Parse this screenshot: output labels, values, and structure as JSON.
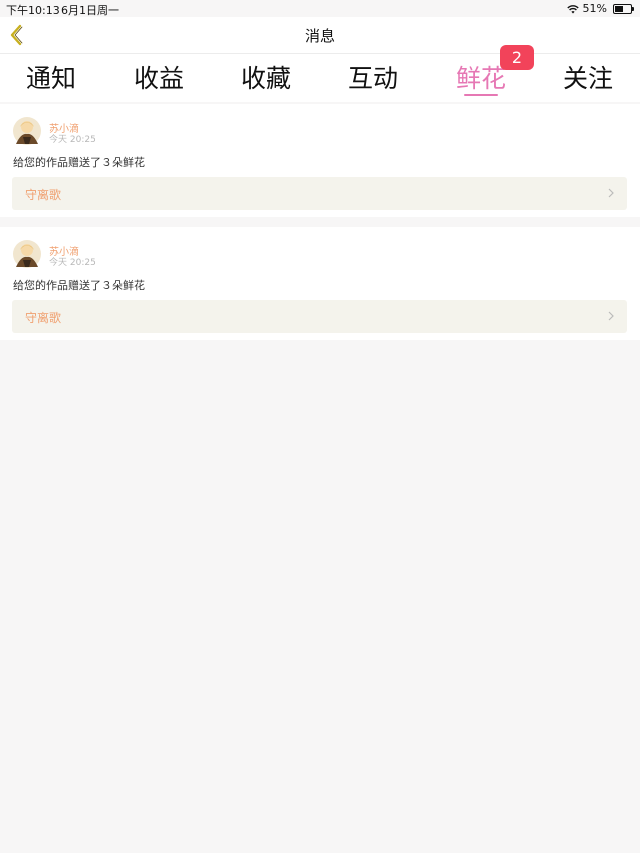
{
  "status_bar": {
    "time": "下午10:13",
    "date": "6月1日周一",
    "battery": "51%",
    "battery_level": 0.51
  },
  "nav": {
    "title": "消息",
    "back_icon": "chevron-left-icon"
  },
  "tabs": [
    {
      "label": "通知"
    },
    {
      "label": "收益"
    },
    {
      "label": "收藏"
    },
    {
      "label": "互动"
    },
    {
      "label": "鲜花",
      "active": true,
      "badge": "2"
    },
    {
      "label": "关注"
    }
  ],
  "notifications": [
    {
      "user": "苏小滴",
      "time": "今天 20:25",
      "message": "给您的作品赠送了３朵鲜花",
      "work_title": "守离歌"
    },
    {
      "user": "苏小滴",
      "time": "今天 20:25",
      "message": "给您的作品赠送了３朵鲜花",
      "work_title": "守离歌"
    }
  ],
  "colors": {
    "accent": "#e678b4",
    "badge": "#f2435a",
    "username": "#f0a070",
    "back_icon": "#c8b020"
  }
}
